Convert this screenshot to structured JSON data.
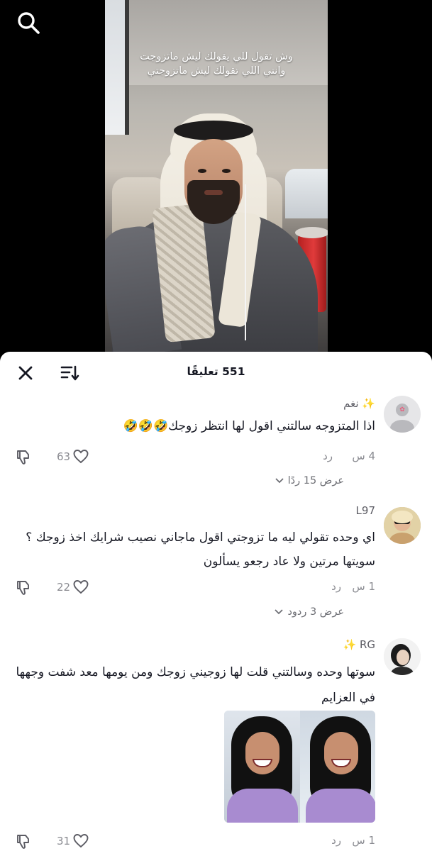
{
  "video": {
    "caption_line1": "وش تقول للي يقولك ليش ماتزوجت",
    "caption_line2": "وانتي اللي تقولك ليش ماتزوجتي"
  },
  "sheet": {
    "comment_count": "551 تعليقًا"
  },
  "comments": [
    {
      "username": "نغم",
      "text": "اذا المتزوجه سالتني اقول لها انتظر زوجك🤣🤣🤣",
      "time": "4 س",
      "reply_label": "رد",
      "likes": "63",
      "view_replies": "عرض 15 ردًا"
    },
    {
      "username": "L97",
      "text": "اي وحده تقولي ليه ما تزوجتي اقول ماجاني نصيب شرايك اخذ زوجك ؟ سويتها مرتين ولا عاد رجعو يسألون",
      "time": "1 س",
      "reply_label": "رد",
      "likes": "22",
      "view_replies": "عرض 3 ردود"
    },
    {
      "username": "RG",
      "text": "سوتها وحده وسالتني قلت لها زوجيني زوجك ومن يومها معد شفت وجهها في العزايم",
      "time": "1 س",
      "reply_label": "رد",
      "likes": "31"
    }
  ],
  "colors": {
    "sheet_bg": "#ffffff",
    "primary_text": "#161823",
    "muted_text": "#8a8b91",
    "sparkle": "#f6c343",
    "video_bg": "#000000"
  }
}
